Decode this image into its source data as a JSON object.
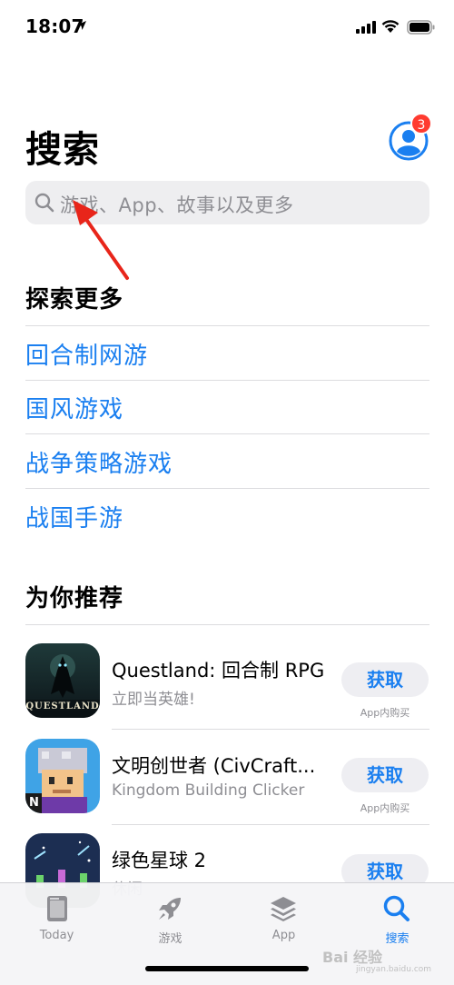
{
  "status": {
    "time": "18:07"
  },
  "header": {
    "title": "搜索",
    "badge_count": "3"
  },
  "search": {
    "placeholder": "游戏、App、故事以及更多"
  },
  "explore": {
    "title": "探索更多",
    "items": [
      "回合制网游",
      "国风游戏",
      "战争策略游戏",
      "战国手游"
    ]
  },
  "recommend": {
    "title": "为你推荐",
    "apps": [
      {
        "name": "Questland: 回合制 RPG",
        "subtitle": "立即当英雄!",
        "button": "获取",
        "iap": "App内购买",
        "icon_text": "QUESTLAND"
      },
      {
        "name": "文明创世者 (CivCraft...",
        "subtitle": "Kingdom Building Clicker",
        "button": "获取",
        "iap": "App内购买",
        "icon_text": "N"
      },
      {
        "name": "绿色星球 2",
        "subtitle": "休闲",
        "button": "获取"
      }
    ]
  },
  "tabs": [
    {
      "label": "Today",
      "icon": "today-icon"
    },
    {
      "label": "游戏",
      "icon": "rocket-icon"
    },
    {
      "label": "App",
      "icon": "layers-icon"
    },
    {
      "label": "搜索",
      "icon": "search-icon",
      "active": true
    }
  ],
  "watermark": {
    "text": "Bai 经验",
    "sub": "jingyan.baidu.com"
  },
  "colors": {
    "accent": "#1a7ff0",
    "badge": "#ff3b30",
    "annotation": "#e8251a"
  }
}
